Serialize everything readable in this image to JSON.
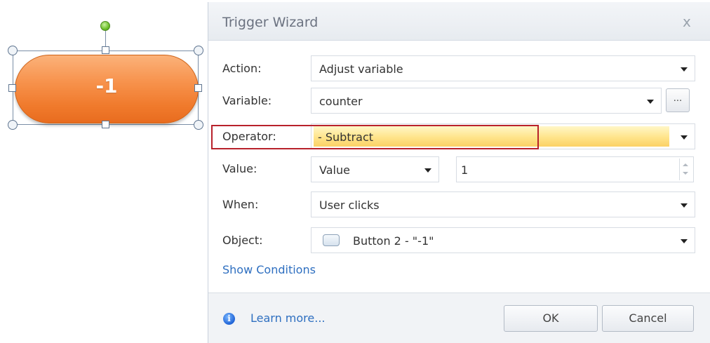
{
  "canvas": {
    "shape_label": "-1"
  },
  "dialog": {
    "title": "Trigger Wizard",
    "close_glyph": "x",
    "fields": {
      "action": {
        "label": "Action:",
        "value": "Adjust variable"
      },
      "variable": {
        "label": "Variable:",
        "value": "counter",
        "browse_label": "..."
      },
      "operator": {
        "label": "Operator:",
        "value": "- Subtract"
      },
      "value": {
        "label": "Value:",
        "type": "Value",
        "amount": "1"
      },
      "when": {
        "label": "When:",
        "value": "User clicks"
      },
      "object": {
        "label": "Object:",
        "value": "Button 2 - \"-1\"",
        "icon": "button-object-icon"
      }
    },
    "show_conditions": "Show Conditions",
    "footer": {
      "info_glyph": "i",
      "learn_more": "Learn more...",
      "ok": "OK",
      "cancel": "Cancel"
    }
  },
  "colors": {
    "highlight": "#b8222b",
    "operator_fill": "#ffe48a",
    "link": "#2e6fc0",
    "shape": "#f07a2c"
  }
}
